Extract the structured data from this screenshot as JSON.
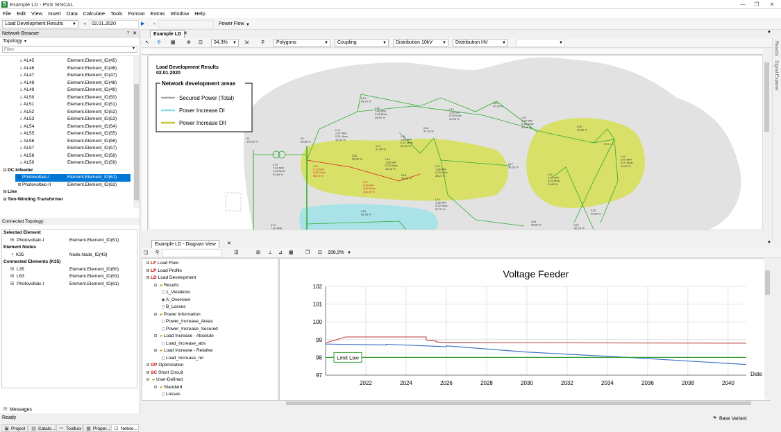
{
  "window": {
    "title": "Example LD - PSS SINCAL"
  },
  "menu": [
    "File",
    "Edit",
    "View",
    "Insert",
    "Data",
    "Calculate",
    "Tools",
    "Format",
    "Extras",
    "Window",
    "Help"
  ],
  "toolbar1": {
    "results_combo": "Load Development Results",
    "date": "02.01.2020",
    "mode": "Power Flow"
  },
  "network_browser": {
    "title": "Network Browser",
    "topology_label": "Topology",
    "filter_placeholder": "Filter",
    "rows": [
      {
        "name": "AL45",
        "element": "Element.Element_ID(45)"
      },
      {
        "name": "AL46",
        "element": "Element.Element_ID(46)"
      },
      {
        "name": "AL47",
        "element": "Element.Element_ID(47)"
      },
      {
        "name": "AL48",
        "element": "Element.Element_ID(48)"
      },
      {
        "name": "AL49",
        "element": "Element.Element_ID(49)"
      },
      {
        "name": "AL50",
        "element": "Element.Element_ID(50)"
      },
      {
        "name": "AL51",
        "element": "Element.Element_ID(51)"
      },
      {
        "name": "AL52",
        "element": "Element.Element_ID(52)"
      },
      {
        "name": "AL53",
        "element": "Element.Element_ID(53)"
      },
      {
        "name": "AL54",
        "element": "Element.Element_ID(54)"
      },
      {
        "name": "AL55",
        "element": "Element.Element_ID(55)"
      },
      {
        "name": "AL56",
        "element": "Element.Element_ID(56)"
      },
      {
        "name": "AL57",
        "element": "Element.Element_ID(57)"
      },
      {
        "name": "AL58",
        "element": "Element.Element_ID(58)"
      },
      {
        "name": "AL59",
        "element": "Element.Element_ID(59)"
      }
    ],
    "dc_infeeder": "DC Infeeder",
    "pv_rows": [
      {
        "name": "Photovoltaic-I",
        "element": "Element.Element_ID(61)"
      },
      {
        "name": "Photovoltaic-II",
        "element": "Element.Element_ID(62)"
      }
    ],
    "line": "Line",
    "two_winding": "Two-Winding Transformer"
  },
  "connected_topology": {
    "title": "Connected Topology:",
    "selected_element_label": "Selected Element",
    "selected": {
      "name": "Photovoltaic-I",
      "element": "Element.Element_ID(61)"
    },
    "element_nodes_label": "Element Nodes",
    "node": {
      "name": "K35",
      "element": "Node.Node_ID(43)"
    },
    "connected_label": "Connected Elements (K35)",
    "connected": [
      {
        "name": "L35",
        "element": "Element.Element_ID(60)"
      },
      {
        "name": "L63",
        "element": "Element.Element_ID(63)"
      },
      {
        "name": "Photovoltaic-I",
        "element": "Element.Element_ID(61)"
      }
    ]
  },
  "bottom_tabs": [
    "Project",
    "Catalo...",
    "Toolbox",
    "Proper...",
    "Netwo..."
  ],
  "messages": "Messages",
  "main_tab": "Example LD",
  "toolbar2": {
    "zoom": "94,3%",
    "layer1": "Polygons",
    "layer2": "Coupling",
    "variant1": "Distribution 10kV",
    "variant2": "Distribution HV"
  },
  "network": {
    "header_title": "Load Development Results",
    "header_date": "02.01.2020",
    "legend_title": "Network development areas",
    "legend_items": [
      {
        "label": "Secured Power (Total)",
        "color": "#a9a9a9"
      },
      {
        "label": "Power Increase DI",
        "color": "#8fd8e0"
      },
      {
        "label": "Power Increase DII",
        "color": "#c8c832"
      }
    ],
    "colors": {
      "grey_area": "#e2e2e2",
      "yellow_area": "#d8e068",
      "cyan_area": "#a9e3e8",
      "green_line": "#2eaa2e",
      "red_line": "#e02020"
    },
    "labels": {
      "k1": "K1\n100,00 %",
      "k3": "K3\n98,86 %",
      "t2": "2T3\n7,84 MW\n1,45 Mvar\n51,86 %",
      "k14": "K14\n98,25 %",
      "l12": "L12\n1,66 MW\n0,28 Mvar\n46,60 %",
      "l10": "L10\n2,47 MW\n0,31 Mvar\n41,81 %",
      "k26": "K26\n98,38 %",
      "l18": "L18\n5,13 MW\n0,81 Mvar\n98,73 %",
      "l17": "L17\n4,36 MW\n0,60 Mvar\n103,49 %",
      "k19": "K19\n97,66 %",
      "l16": "L16\n1,85 MW\n0,21 Mvar\n46,25 %",
      "l15": "L15\n1,85 MW\n0,23 Mvar\n46,26 %",
      "k18": "K18\n97,34 %",
      "l19": "L19\n1,20 MW\n0,18 Mvar\n30,05 %",
      "k21": "K21\n97,24 %",
      "l13": "L13\n1,84 MW\n0,23 Mvar\n38,21 %",
      "l14": "L14\n2,38 MW\n0,22 Mvar\n57,32 %",
      "k16": "K16\n98,03 %",
      "k17": "K17\n96,35 %",
      "l20": "L20\n1,25 MW\n0,18 Mvar\n30,05 %",
      "k22": "K22\n96,35 %",
      "l24": "L24\n1,00 MW\n0,16 Mvar\n24,63 %",
      "l22": "L22\n0,49 MW\n0,07 Mvar\n12,00 %",
      "k27": "K27\n96,78 %",
      "k25": "K25\n95,89 %",
      "k28": "K28\n95,83 %",
      "k30": "K30\n98,38 %",
      "t4": "2T4\n7,90 MW",
      "gdc": "G D • C"
    }
  },
  "diagram_view": {
    "tab": "Example LD - Diagram View",
    "zoom": "156,9%",
    "tree": [
      {
        "level": 0,
        "prefix": "LF",
        "label": "Load Flow",
        "prefix_color": "#c00000"
      },
      {
        "level": 0,
        "prefix": "LP",
        "label": "Load Profile",
        "prefix_color": "#c00000"
      },
      {
        "level": 0,
        "prefix": "LD",
        "label": "Load Development",
        "prefix_color": "#c00000"
      },
      {
        "level": 1,
        "prefix": "",
        "label": "Results",
        "folder": true
      },
      {
        "level": 2,
        "prefix": "",
        "label": "1_Violations",
        "radio": false
      },
      {
        "level": 2,
        "prefix": "",
        "label": "A_Overview",
        "radio": true
      },
      {
        "level": 2,
        "prefix": "",
        "label": "B_Losses",
        "radio": false
      },
      {
        "level": 1,
        "prefix": "",
        "label": "Power Information",
        "folder": true
      },
      {
        "level": 2,
        "prefix": "",
        "label": "Power_Increase_Areas",
        "radio": false
      },
      {
        "level": 2,
        "prefix": "",
        "label": "Power_Increase_Secured",
        "radio": false
      },
      {
        "level": 1,
        "prefix": "",
        "label": "Load Increase - Absolute",
        "folder": true
      },
      {
        "level": 2,
        "prefix": "",
        "label": "Load_Increase_abs",
        "radio": false
      },
      {
        "level": 1,
        "prefix": "",
        "label": "Load Increase - Relative",
        "folder": true
      },
      {
        "level": 2,
        "prefix": "",
        "label": "Load_Increase_rel",
        "radio": false
      },
      {
        "level": 0,
        "prefix": "OP",
        "label": "Optimization",
        "prefix_color": "#c00000"
      },
      {
        "level": 0,
        "prefix": "SC",
        "label": "Short Circuit",
        "prefix_color": "#c00000"
      },
      {
        "level": 0,
        "prefix": "",
        "label": "User-Defined",
        "folder": true
      },
      {
        "level": 1,
        "prefix": "",
        "label": "Standard",
        "folder": true
      },
      {
        "level": 2,
        "prefix": "",
        "label": "Losses",
        "radio": false
      }
    ]
  },
  "chart_data": {
    "type": "line",
    "title": "Voltage Feeder",
    "xlabel": "Date",
    "ylabel": "",
    "xlim": [
      2020.0,
      2040.9
    ],
    "ylim": [
      97,
      102
    ],
    "xticks": [
      2022,
      2024,
      2026,
      2028,
      2030,
      2032,
      2034,
      2036,
      2038,
      2040
    ],
    "yticks": [
      97,
      98,
      99,
      100,
      101,
      102
    ],
    "annotation": "Limit Low",
    "series": [
      {
        "color": "#c0504d",
        "x": [
          2020.0,
          2021.0,
          2025.0,
          2025.0,
          2025.5,
          2025.5,
          2026.0,
          2027.0,
          2040.9
        ],
        "y": [
          98.82,
          99.15,
          99.15,
          98.97,
          98.92,
          98.87,
          98.83,
          98.83,
          98.8
        ]
      },
      {
        "color": "#4472c4",
        "x": [
          2020.0,
          2023.0,
          2023.0,
          2026.0,
          2026.0,
          2030.0,
          2035.0,
          2040.9
        ],
        "y": [
          98.75,
          98.7,
          98.74,
          98.6,
          98.65,
          98.3,
          98.0,
          97.6
        ]
      },
      {
        "color": "#2e9b2e",
        "x": [
          2020.0,
          2040.9
        ],
        "y": [
          98.0,
          98.0
        ]
      }
    ]
  },
  "status": {
    "ready": "Ready",
    "variant": "Base Variant"
  },
  "side_tabs": [
    "Results",
    "Signal Explorer"
  ]
}
